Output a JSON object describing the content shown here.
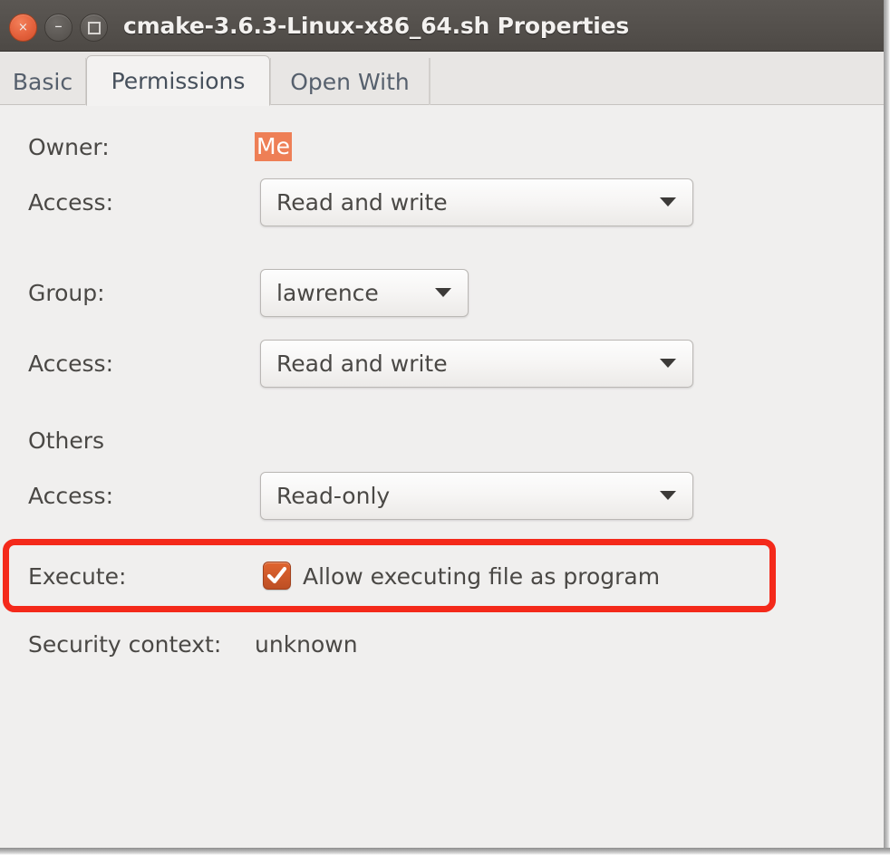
{
  "window": {
    "title": "cmake-3.6.3-Linux-x86_64.sh Properties",
    "controls": {
      "close": "×",
      "minimize": "–",
      "maximize": ""
    },
    "titlebar_color": "#534f4b",
    "background_color": "#f0efee"
  },
  "tabs": [
    {
      "label": "Basic",
      "active": false
    },
    {
      "label": "Permissions",
      "active": true
    },
    {
      "label": "Open With",
      "active": false
    }
  ],
  "permissions": {
    "owner": {
      "label": "Owner:",
      "value": "Me",
      "highlight_color": "#ee7f56"
    },
    "owner_access": {
      "label": "Access:",
      "value": "Read and write"
    },
    "group": {
      "label": "Group:",
      "value": "lawrence"
    },
    "group_access": {
      "label": "Access:",
      "value": "Read and write"
    },
    "others": {
      "label": "Others"
    },
    "others_access": {
      "label": "Access:",
      "value": "Read-only"
    },
    "execute": {
      "label": "Execute:",
      "checkbox_label": "Allow executing file as program",
      "checked": true,
      "checkbox_color": "#cf5a2a"
    },
    "security_context": {
      "label": "Security context:",
      "value": "unknown"
    }
  },
  "annotation": {
    "color": "#f4291a",
    "target": "execute-row"
  }
}
